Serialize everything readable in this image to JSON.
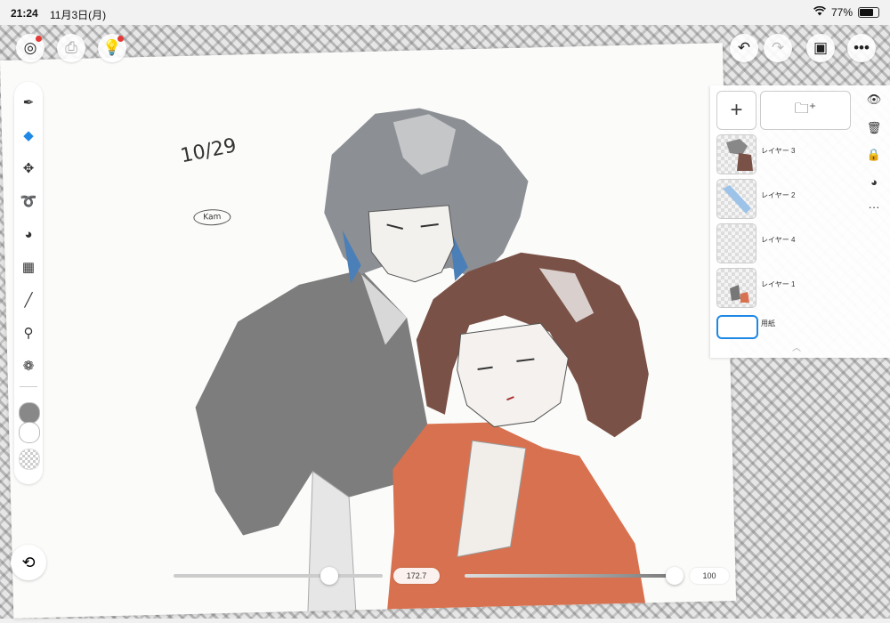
{
  "status": {
    "time": "21:24",
    "date": "11月3日(月)",
    "battery": "77%",
    "battery_level": 0.77
  },
  "canvas": {
    "handwritten_date": "10/29",
    "doodle_label": "Kam"
  },
  "layers": {
    "items": [
      {
        "name": "レイヤー 3"
      },
      {
        "name": "レイヤー 2"
      },
      {
        "name": "レイヤー 4"
      },
      {
        "name": "レイヤー 1"
      }
    ],
    "paper_label": "用紙"
  },
  "sliders": {
    "size_value": "172.7",
    "opacity_value": "100"
  },
  "colors": {
    "accent": "#1e88e5",
    "primary_swatch": "#888888",
    "secondary_swatch": "#ffffff"
  }
}
